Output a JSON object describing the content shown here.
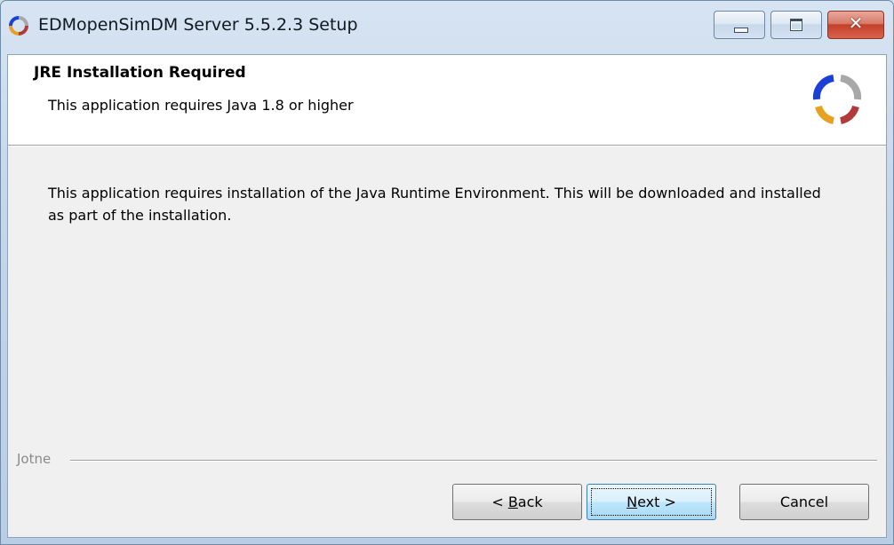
{
  "window": {
    "title": "EDMopenSimDM Server 5.5.2.3 Setup",
    "icon": "setup-logo-icon",
    "caption_buttons": [
      "minimize-icon",
      "maximize-icon",
      "close-icon"
    ],
    "close_glyph": "✕"
  },
  "header": {
    "title": "JRE Installation Required",
    "subtitle": "This application requires Java 1.8 or higher",
    "logo": "setup-logo-icon"
  },
  "body": {
    "message": "This application requires installation of the Java Runtime Environment. This will be downloaded and installed as part of the installation."
  },
  "branding": {
    "label": "Jotne"
  },
  "buttons": {
    "back": {
      "prefix": "< ",
      "accel": "B",
      "rest": "ack"
    },
    "next": {
      "prefix": "",
      "accel": "N",
      "rest": "ext >"
    },
    "cancel": {
      "label": "Cancel"
    }
  },
  "colors": {
    "logo_blue": "#1c3fd6",
    "logo_orange": "#e8a020",
    "logo_red": "#b23a3a",
    "logo_gray": "#a8a8a8"
  }
}
